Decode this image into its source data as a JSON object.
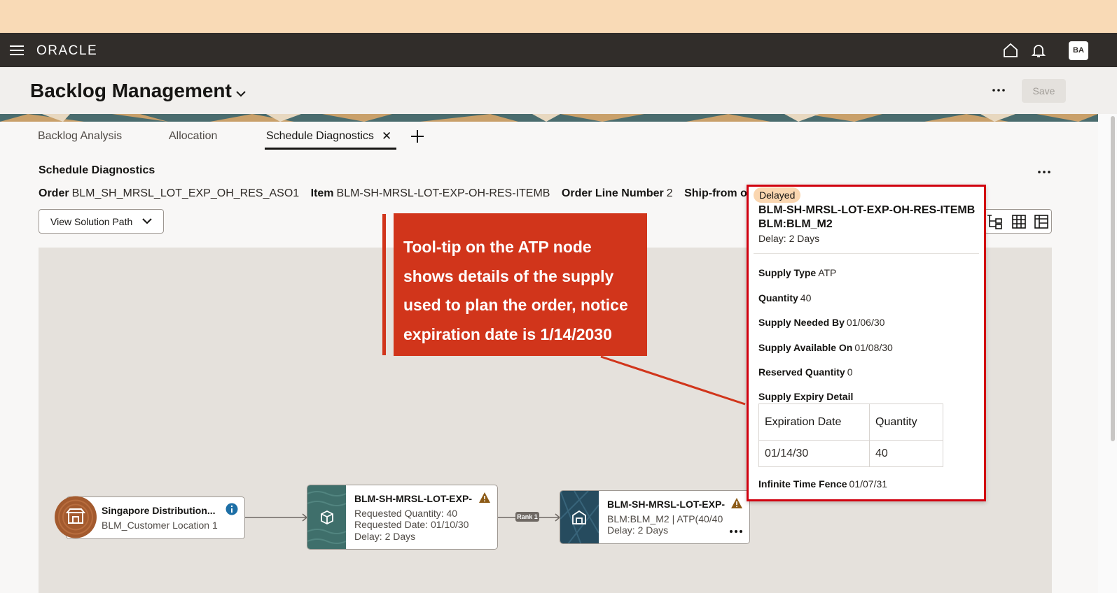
{
  "navbar": {
    "brand": "ORACLE",
    "user_initials": "BA"
  },
  "header": {
    "title": "Backlog Management",
    "save_label": "Save"
  },
  "tabs": [
    {
      "label": "Backlog Analysis"
    },
    {
      "label": "Allocation"
    },
    {
      "label": "Schedule Diagnostics"
    }
  ],
  "section": {
    "title": "Schedule Diagnostics",
    "order_label": "Order",
    "order_value": "BLM_SH_MRSL_LOT_EXP_OH_RES_ASO1",
    "item_label": "Item",
    "item_value": "BLM-SH-MRSL-LOT-EXP-OH-RES-ITEMB",
    "line_label": "Order Line Number",
    "line_value": "2",
    "shipfrom_label": "Ship-from orga",
    "view_button": "View Solution Path"
  },
  "nodes": {
    "customer": {
      "name": "Singapore Distribution...",
      "location": "BLM_Customer Location 1"
    },
    "item": {
      "name": "BLM-SH-MRSL-LOT-EXP-",
      "qty": "Requested Quantity: 40",
      "date": "Requested Date: 01/10/30",
      "delay": "Delay: 2 Days"
    },
    "rank": "Rank 1",
    "atp": {
      "name": "BLM-SH-MRSL-LOT-EXP-",
      "supply": "BLM:BLM_M2 | ATP(40/40",
      "delay": "Delay: 2 Days"
    }
  },
  "callout": {
    "lines": [
      "Tool-tip on the ATP node",
      "shows details of the supply",
      "used to plan the order, notice",
      "expiration date is 1/14/2030"
    ]
  },
  "tooltip": {
    "status": "Delayed",
    "title1": "BLM-SH-MRSL-LOT-EXP-OH-RES-ITEMB",
    "title2": "BLM:BLM_M2",
    "delay": "Delay: 2 Days",
    "supply_type_label": "Supply Type",
    "supply_type": "ATP",
    "quantity_label": "Quantity",
    "quantity": "40",
    "needed_label": "Supply Needed By",
    "needed": "01/06/30",
    "available_label": "Supply Available On",
    "available": "01/08/30",
    "reserved_label": "Reserved Quantity",
    "reserved": "0",
    "expiry_label": "Supply Expiry Detail",
    "table_headers": [
      "Expiration Date",
      "Quantity"
    ],
    "table_rows": [
      [
        "01/14/30",
        "40"
      ]
    ],
    "fence_label": "Infinite Time Fence",
    "fence": "01/07/31"
  }
}
